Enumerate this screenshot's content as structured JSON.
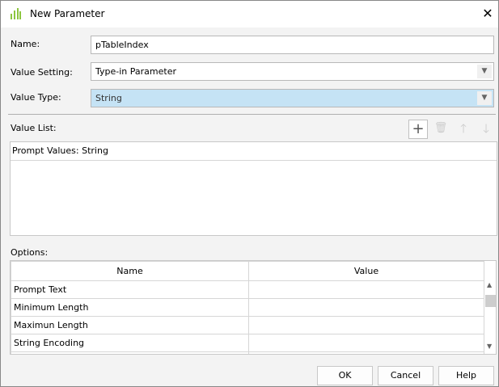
{
  "dialog": {
    "title": "New Parameter",
    "icon": "parameter-icon",
    "close_icon": "close-icon"
  },
  "form": {
    "name_label": "Name:",
    "name_value": "pTableIndex",
    "value_setting_label": "Value Setting:",
    "value_setting_value": "Type-in Parameter",
    "value_type_label": "Value Type:",
    "value_type_value": "String",
    "value_type_highlight": "#c5e3f5"
  },
  "value_list": {
    "label": "Value List:",
    "header": "Prompt Values: String",
    "toolbar": [
      {
        "icon": "plus-icon",
        "enabled": true
      },
      {
        "icon": "trash-icon",
        "enabled": false
      },
      {
        "icon": "arrow-up-icon",
        "enabled": false
      },
      {
        "icon": "arrow-down-icon",
        "enabled": false
      }
    ]
  },
  "options": {
    "label": "Options:",
    "columns": [
      "Name",
      "Value"
    ],
    "rows": [
      {
        "name": "Prompt Text",
        "value": ""
      },
      {
        "name": "Minimum Length",
        "value": ""
      },
      {
        "name": "Maximun Length",
        "value": ""
      },
      {
        "name": "String Encoding",
        "value": ""
      }
    ]
  },
  "buttons": {
    "ok": "OK",
    "cancel": "Cancel",
    "help": "Help"
  }
}
